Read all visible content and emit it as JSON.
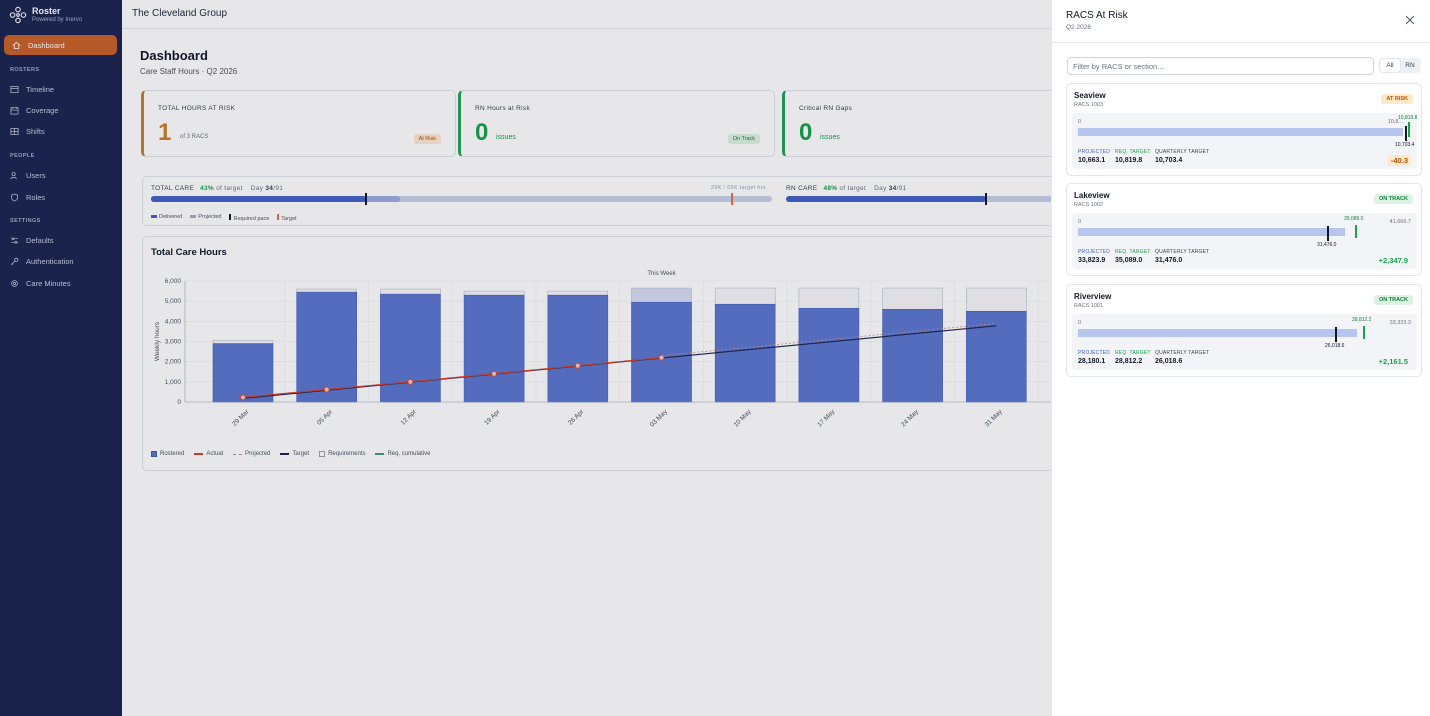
{
  "brand": {
    "name": "Roster",
    "sub": "Powered by Inervo"
  },
  "nav": {
    "dashboard": "Dashboard",
    "section_rosters": "ROSTERS",
    "timeline": "Timeline",
    "coverage": "Coverage",
    "shifts": "Shifts",
    "section_people": "PEOPLE",
    "users": "Users",
    "roles": "Roles",
    "section_settings": "SETTINGS",
    "defaults": "Defaults",
    "authentication": "Authentication",
    "care_minutes": "Care Minutes"
  },
  "topbar": {
    "org": "The Cleveland Group"
  },
  "dashboard": {
    "title": "Dashboard",
    "subtitle": "Care Staff Hours · Q2 2026",
    "kpis": [
      {
        "label": "TOTAL HOURS AT RISK",
        "value": "1",
        "unit": "of 3 RACS",
        "badge": "At Risk"
      },
      {
        "label": "RN Hours at Risk",
        "value": "0",
        "unit": "issues",
        "badge": "On Track"
      },
      {
        "label": "Critical RN Gaps",
        "value": "0",
        "unit": "issues"
      }
    ],
    "progress": {
      "total_label": "TOTAL CARE",
      "total_pct": "43%",
      "total_of": "of target",
      "total_day_prefix": "Day",
      "total_day": "34",
      "total_day_suffix": "/91",
      "total_right": "29K / 65K target hrs",
      "rn_label": "RN CARE",
      "rn_pct": "48%",
      "rn_of": "of target",
      "rn_day_prefix": "Day",
      "rn_day": "34",
      "rn_day_suffix": "/91",
      "legend": [
        "Delivered",
        "Projected",
        "Required pace",
        "Target"
      ]
    }
  },
  "chart_data": {
    "type": "bar",
    "title": "Total Care Hours",
    "ylabel": "Weekly hours",
    "ylim": [
      0,
      6000
    ],
    "yticks": [
      "0",
      "1,000",
      "2,000",
      "3,000",
      "4,000",
      "5,000",
      "6,000"
    ],
    "annotation": "This Week",
    "categories": [
      "29 Mar",
      "05 Apr",
      "12 Apr",
      "19 Apr",
      "26 Apr",
      "03 May",
      "10 May",
      "17 May",
      "24 May",
      "31 May"
    ],
    "series": [
      {
        "name": "Rostered",
        "values": [
          2900,
          5450,
          5350,
          5300,
          5300,
          4950,
          4850,
          4650,
          4600,
          4500
        ]
      },
      {
        "name": "Requirements",
        "values": [
          3050,
          5600,
          5600,
          5500,
          5500,
          5650,
          5650,
          5650,
          5650,
          5650
        ]
      },
      {
        "name": "Actual",
        "values": [
          230,
          620,
          1000,
          1400,
          1800,
          2200
        ]
      },
      {
        "name": "Target",
        "values": [
          180,
          580,
          980,
          1380,
          1780,
          2180,
          2580,
          2980,
          3380,
          3780
        ]
      }
    ],
    "legend": [
      "Rostered",
      "Actual",
      "Projected",
      "Target",
      "Requirements",
      "Req. cumulative"
    ]
  },
  "drawer": {
    "title": "RACS At Risk",
    "subtitle": "Q2 2026",
    "filter_placeholder": "Filter by RACS or section...",
    "seg_all": "All",
    "seg_rn": "RN",
    "k_projected": "PROJECTED",
    "k_req": "REQ. TARGET",
    "k_quarterly": "QUARTERLY TARGET",
    "zero": "0",
    "cards": [
      {
        "name": "Seaview",
        "id": "RACS 1003",
        "badge": "AT RISK",
        "max": "10,8...",
        "req_tag": "10,819.8",
        "q_tag": "10,703.4",
        "projected": "10,663.1",
        "req": "10,819.8",
        "quarterly": "10,703.4",
        "delta": "-40.3",
        "projected_pct": 0.985,
        "req_pct": 1.0,
        "quarterly_pct": 0.99
      },
      {
        "name": "Lakeview",
        "id": "RACS 1002",
        "badge": "ON TRACK",
        "max": "41,666.7",
        "req_tag": "35,089.0",
        "q_tag": "31,476.0",
        "projected": "33,823.9",
        "req": "35,089.0",
        "quarterly": "31,476.0",
        "delta": "+2,347.9",
        "projected_pct": 0.81,
        "req_pct": 0.84,
        "quarterly_pct": 0.755
      },
      {
        "name": "Riverview",
        "id": "RACS 1001",
        "badge": "ON TRACK",
        "max": "33,333.3",
        "req_tag": "28,812.2",
        "q_tag": "26,018.6",
        "projected": "28,180.1",
        "req": "28,812.2",
        "quarterly": "26,018.6",
        "delta": "+2,161.5",
        "projected_pct": 0.845,
        "req_pct": 0.865,
        "quarterly_pct": 0.78
      }
    ]
  }
}
